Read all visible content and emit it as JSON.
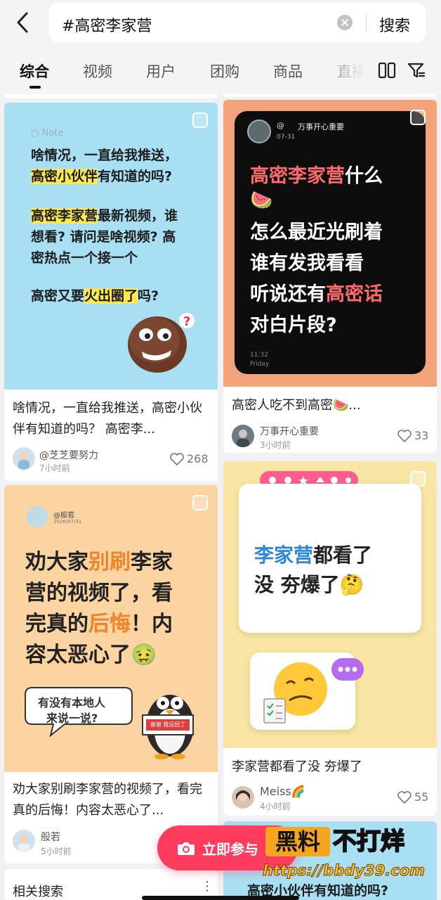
{
  "search": {
    "query": "#高密李家营",
    "button_label": "搜索"
  },
  "tabs": [
    {
      "label": "综合",
      "active": true
    },
    {
      "label": "视频"
    },
    {
      "label": "用户"
    },
    {
      "label": "团购"
    },
    {
      "label": "商品"
    },
    {
      "label": "直播"
    }
  ],
  "cards": [
    {
      "cover_note": "Note",
      "cover_lines": [
        "啥情况，一直给我推送，",
        "高密小伙伴有知道的吗?",
        "高密李家营最新视频，谁",
        "想看? 请问是啥视频? 高",
        "密热点一个接一个",
        "高密又要火出圈了吗?"
      ],
      "title": "啥情况，一直给我推送，高密小伙伴有知道的吗？ 高密李...",
      "author": "@芝芝要努力",
      "time": "7小时前",
      "likes": "268"
    },
    {
      "cover_handle": "@",
      "cover_account": "万事开心重要",
      "cover_date": "07-31",
      "cover_lines": [
        "高密李家营什么",
        "🍉",
        "怎么最近光刷着",
        "谁有发我看看",
        "听说还有高密话",
        "对白片段?"
      ],
      "cover_clock": "11:32",
      "cover_day": "Friday",
      "title": "高密人吃不到高密🍉...",
      "author": "万事开心重要",
      "time": "3小时前",
      "likes": "33"
    },
    {
      "cover_handle": "@般若",
      "cover_date": "2026/07/31",
      "cover_lines": [
        "劝大家别刷李家",
        "营的视频了，看",
        "完真的后悔！内",
        "容太恶心了🤢"
      ],
      "cover_bubble": [
        "有没有本地人",
        "来说一说?"
      ],
      "cover_sign": "谢谢  我没招了",
      "title": "劝大家别刷李家营的视频了，看完真的后悔！内容太恶心了...",
      "author": "般若",
      "time": "5小时前"
    },
    {
      "cover_lines": [
        "李家营都看了",
        "没 夯爆了🤔"
      ],
      "title": "李家营都看了没 夯爆了",
      "author": "Meiss🌈",
      "time": "4小时前",
      "likes": "55"
    },
    {
      "cover_lines": [
        "高密小伙伴有知道的吗?"
      ]
    }
  ],
  "related_search_label": "相关搜索",
  "float_button_label": "立即参与",
  "watermark": {
    "brand_a": "黑料",
    "brand_b": "不打烊",
    "url": "https://bbdy39.com"
  },
  "colors": {
    "accent": "#ff3c5e",
    "card1_bg": "#a9dff2",
    "card2_bg": "#f2a37a",
    "card3_bg": "#fbd4a2",
    "card4_bg": "#f9e6a4"
  }
}
